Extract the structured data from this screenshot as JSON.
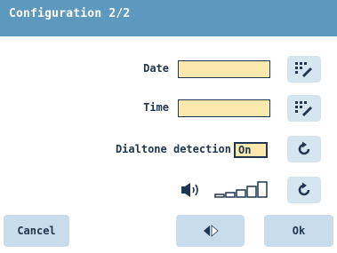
{
  "header": {
    "title": "Configuration 2/2"
  },
  "fields": {
    "date_label": "Date",
    "date_value": "",
    "time_label": "Time",
    "time_value": "",
    "dialtone_label": "Dialtone detection",
    "dialtone_value": "On"
  },
  "volume": {
    "level": 4,
    "max": 5
  },
  "footer": {
    "cancel_label": "Cancel",
    "ok_label": "Ok"
  },
  "colors": {
    "header_bg": "#5d98bf",
    "field_bg": "#fbe8ad",
    "button_bg": "#c9dceb",
    "text": "#1f3550"
  },
  "icons": [
    "keypad-edit-icon",
    "reset-icon",
    "speaker-icon",
    "volume-bars-icon",
    "left-right-arrows-icon"
  ]
}
